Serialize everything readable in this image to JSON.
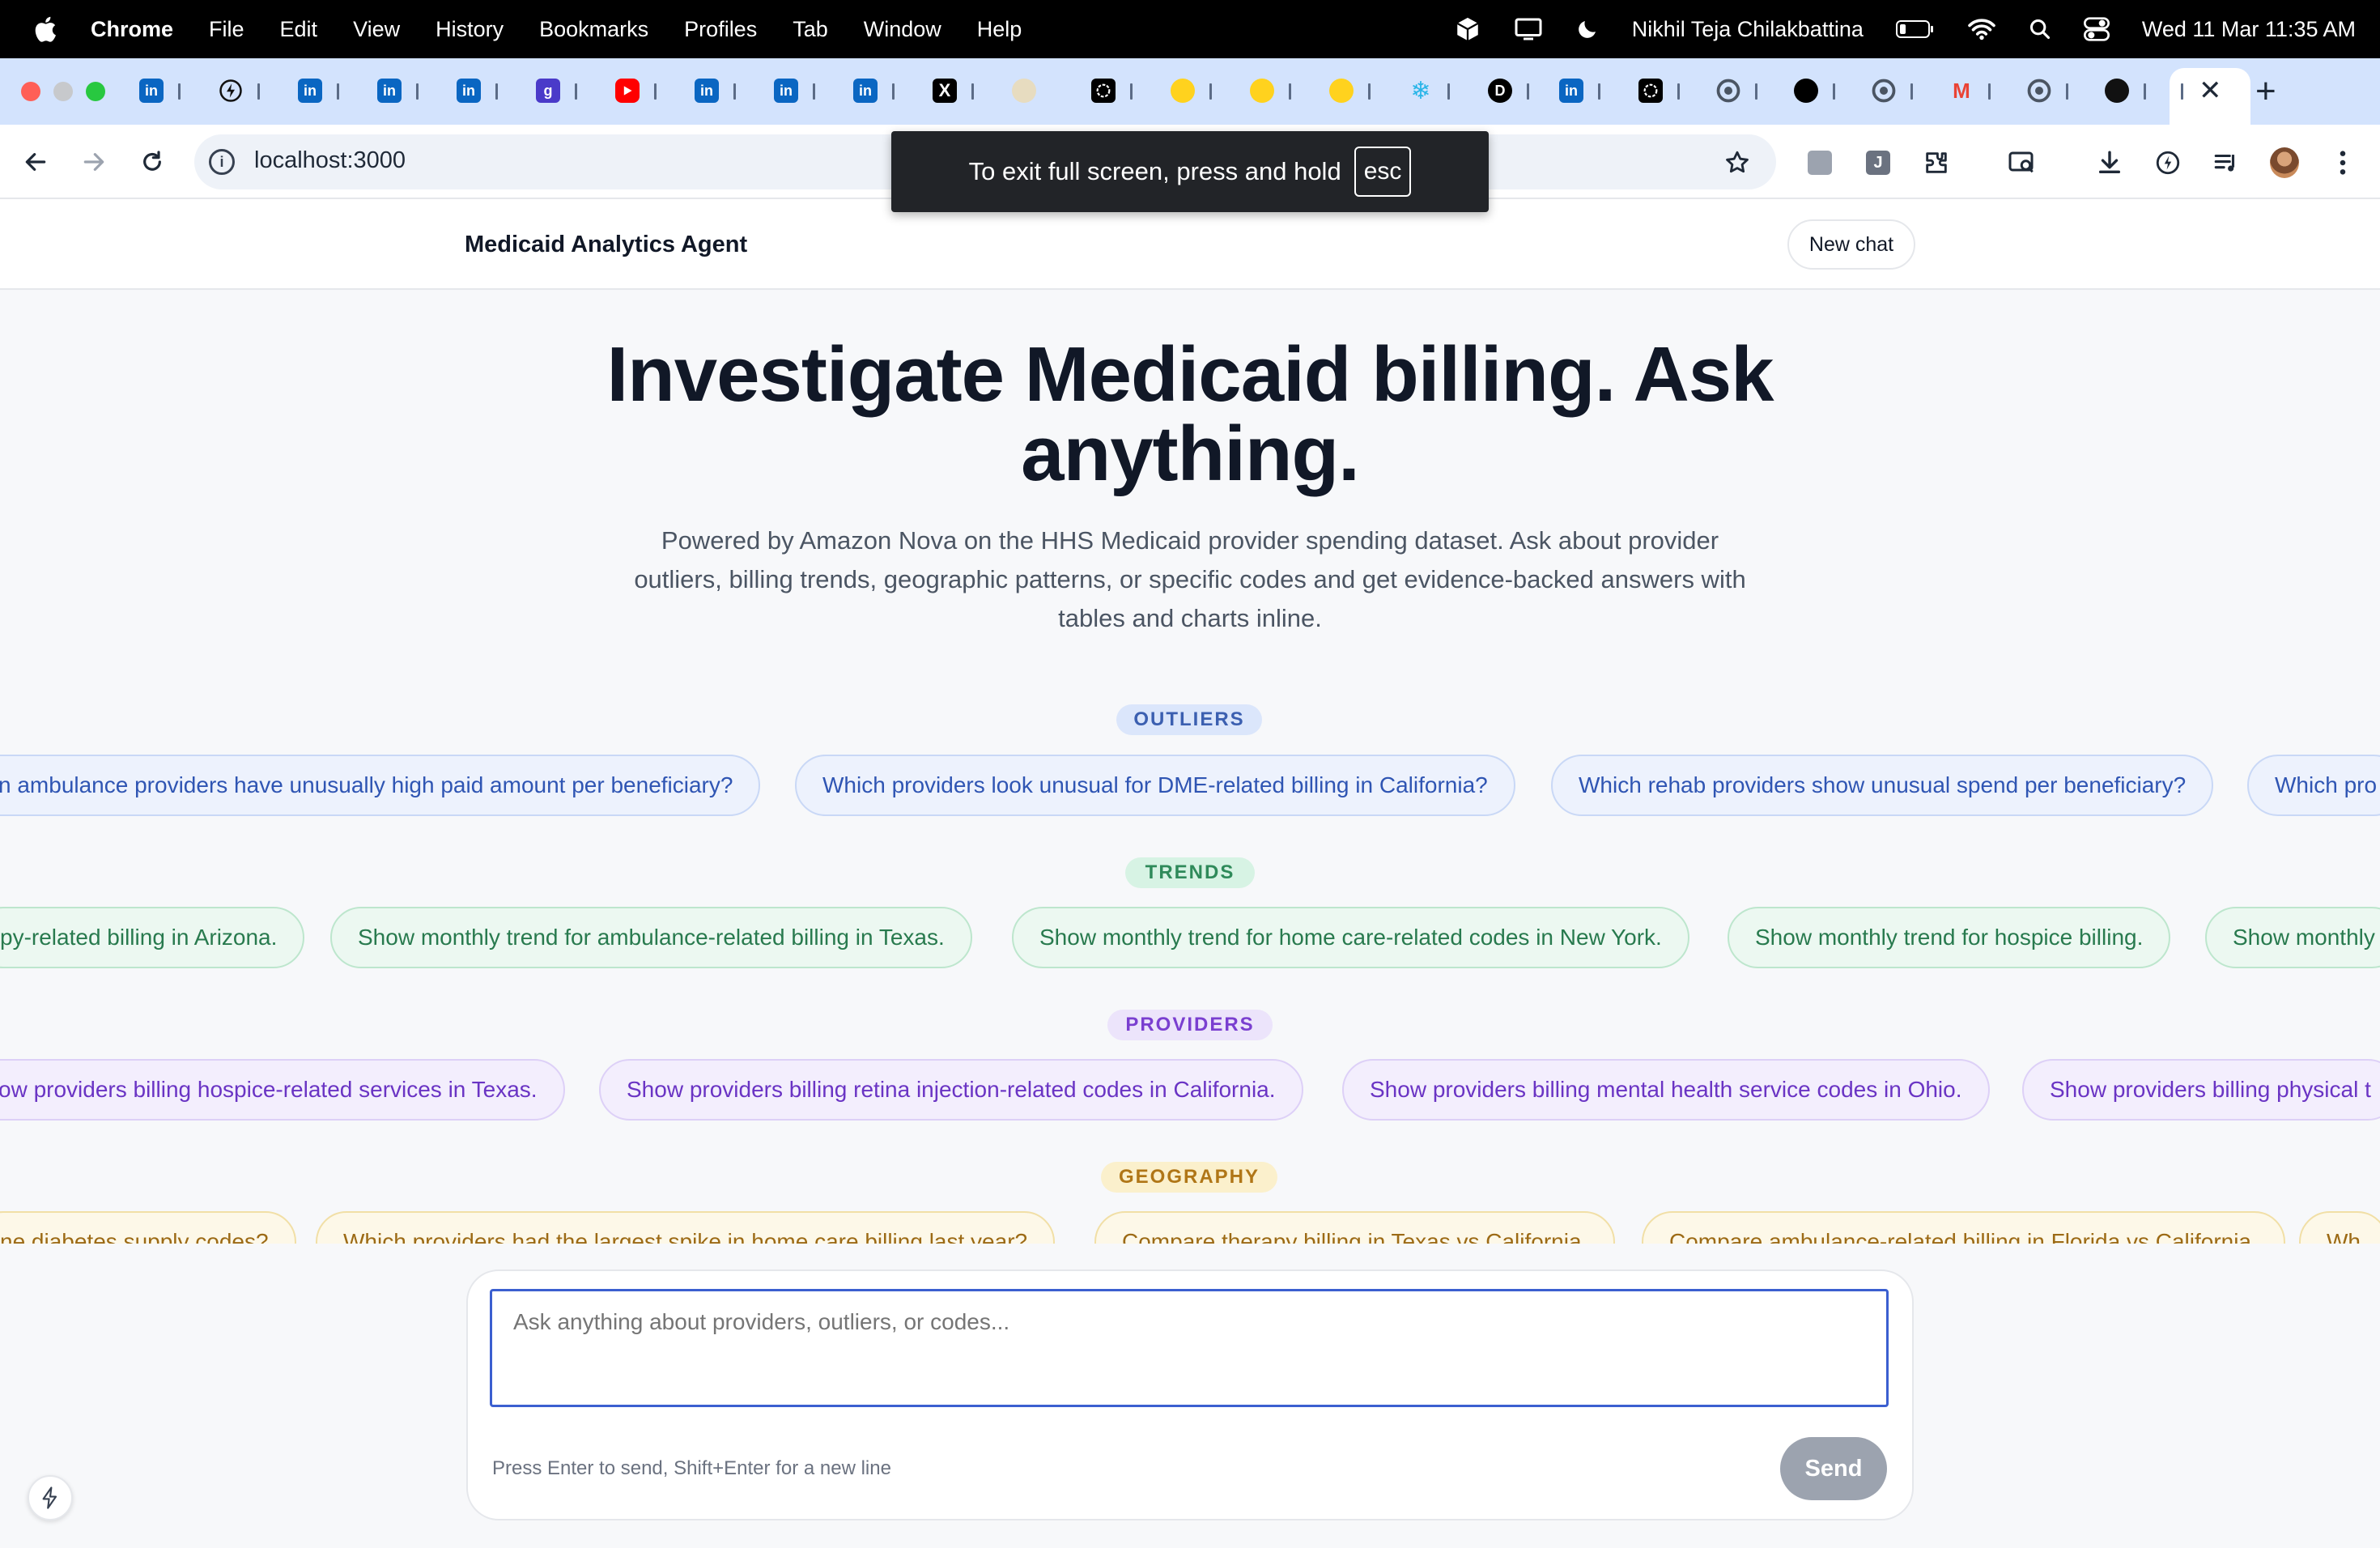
{
  "menubar": {
    "app": "Chrome",
    "items": [
      "File",
      "Edit",
      "View",
      "History",
      "Bookmarks",
      "Profiles",
      "Tab",
      "Window",
      "Help"
    ],
    "user": "Nikhil Teja Chilakbattina",
    "clock": "Wed 11 Mar  11:35 AM"
  },
  "browser": {
    "url": "localhost:3000",
    "fullscreen_toast": {
      "text": "To exit full screen, press and hold",
      "key": "esc"
    }
  },
  "app": {
    "brand": "Medicaid Analytics Agent",
    "new_chat": "New chat"
  },
  "hero": {
    "title_line1": "Investigate Medicaid billing. Ask",
    "title_line2": "anything.",
    "subtitle_line1": "Powered by Amazon Nova on the HHS Medicaid provider spending dataset. Ask about provider",
    "subtitle_line2": "outliers, billing trends, geographic patterns, or specific codes and get evidence-backed answers with",
    "subtitle_line3": "tables and charts inline."
  },
  "categories": {
    "outliers": {
      "label": "OUTLIERS",
      "prompts": [
        "n ambulance providers have unusually high paid amount per beneficiary?",
        "Which providers look unusual for DME-related billing in California?",
        "Which rehab providers show unusual spend per beneficiary?",
        "Which pro"
      ]
    },
    "trends": {
      "label": "TRENDS",
      "prompts": [
        "py-related billing in Arizona.",
        "Show monthly trend for ambulance-related billing in Texas.",
        "Show monthly trend for home care-related codes in New York.",
        "Show monthly trend for hospice billing.",
        "Show monthly"
      ]
    },
    "providers": {
      "label": "PROVIDERS",
      "prompts": [
        "ow providers billing hospice-related services in Texas.",
        "Show providers billing retina injection-related codes in California.",
        "Show providers billing mental health service codes in Ohio.",
        "Show providers billing physical t"
      ]
    },
    "geography": {
      "label": "GEOGRAPHY",
      "prompts": [
        "ne diabetes supply codes?",
        "Which providers had the largest spike in home care billing last year?",
        "Compare therapy billing in Texas vs California.",
        "Compare ambulance-related billing in Florida vs California.",
        "Wh"
      ]
    }
  },
  "composer": {
    "placeholder": "Ask anything about providers, outliers, or codes...",
    "hint": "Press Enter to send, Shift+Enter for a new line",
    "send": "Send"
  }
}
